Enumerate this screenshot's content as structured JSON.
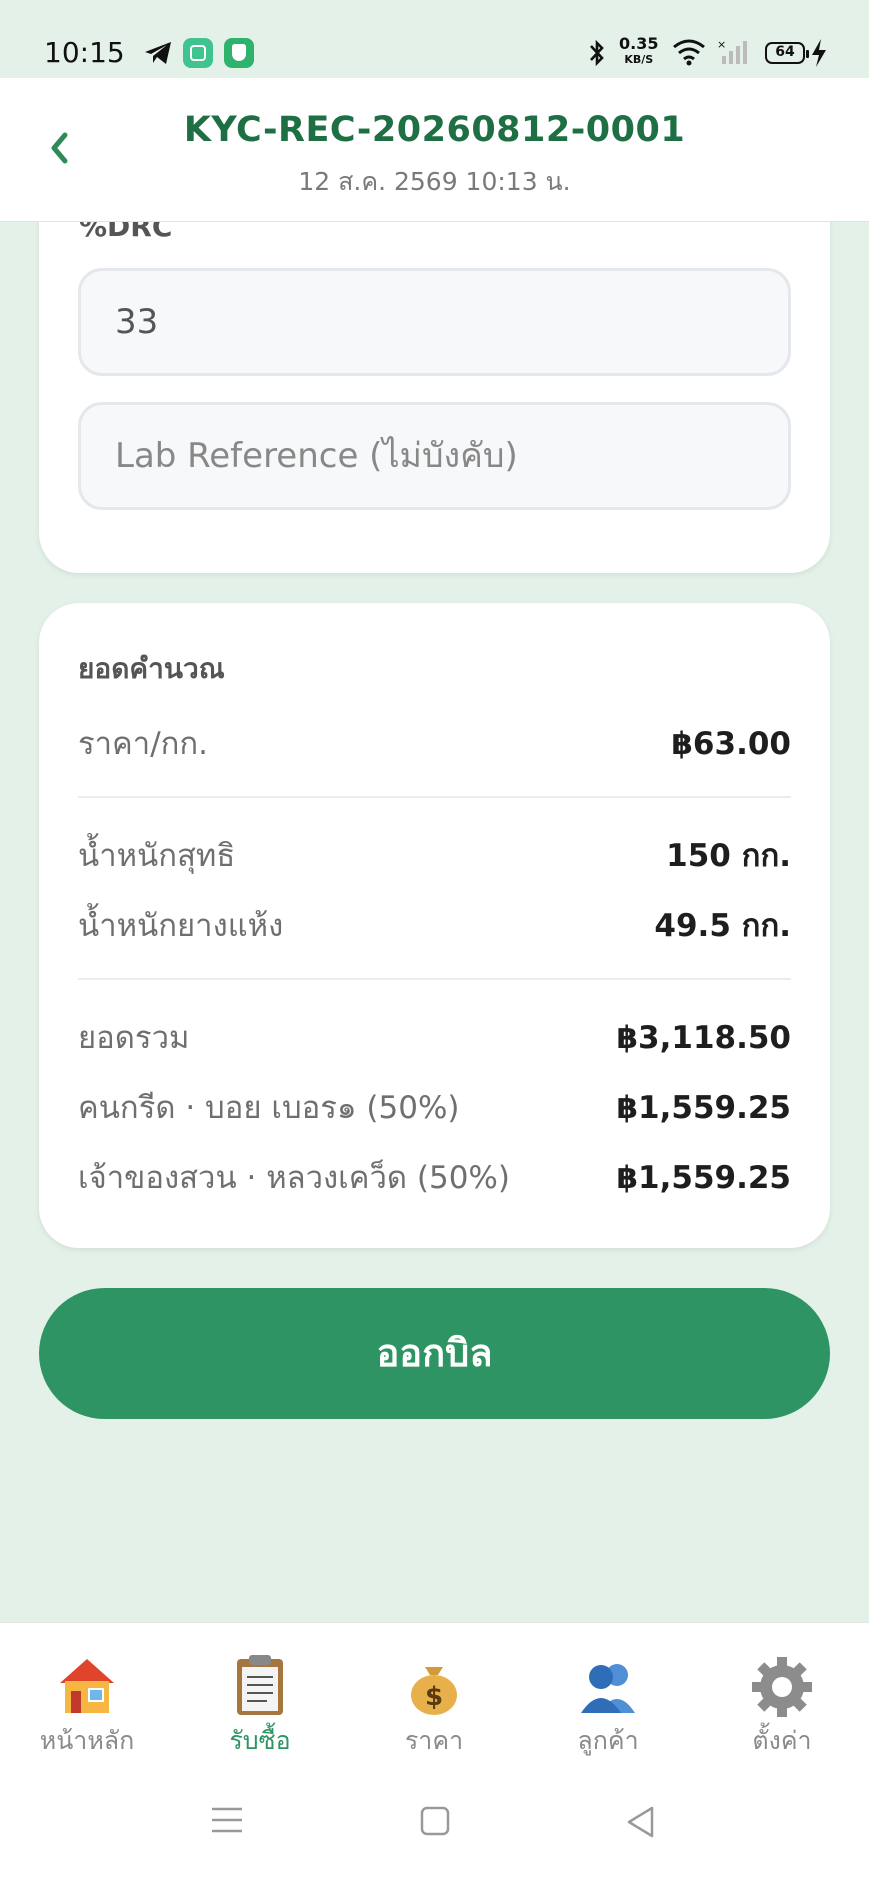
{
  "status_bar": {
    "time": "10:15",
    "network_speed": "0.35",
    "network_unit": "KB/S",
    "battery": "64"
  },
  "header": {
    "title": "KYC-REC-20260812-0001",
    "subtitle": "12 ส.ค. 2569 10:13 น."
  },
  "form": {
    "drc_label": "%DRC",
    "drc_value": "33",
    "lab_reference_placeholder": "Lab Reference (ไม่บังคับ)"
  },
  "calculation": {
    "title": "ยอดคำนวณ",
    "price_per_kg_label": "ราคา/กก.",
    "price_per_kg_value": "฿63.00",
    "net_weight_label": "น้ำหนักสุทธิ",
    "net_weight_value": "150 กก.",
    "dry_rubber_label": "น้ำหนักยางแห้ง",
    "dry_rubber_value": "49.5 กก.",
    "total_label": "ยอดรวม",
    "total_value": "฿3,118.50",
    "tapper_label": "คนกรีด · บอย เบอร๑ (50%)",
    "tapper_value": "฿1,559.25",
    "owner_label": "เจ้าของสวน · หลวงเคว็ด (50%)",
    "owner_value": "฿1,559.25"
  },
  "actions": {
    "issue_bill": "ออกบิล"
  },
  "nav": {
    "items": [
      {
        "label": "หน้าหลัก",
        "icon": "house-icon"
      },
      {
        "label": "รับซื้อ",
        "icon": "clipboard-icon"
      },
      {
        "label": "ราคา",
        "icon": "money-bag-icon"
      },
      {
        "label": "ลูกค้า",
        "icon": "users-icon"
      },
      {
        "label": "ตั้งค่า",
        "icon": "gear-icon"
      }
    ],
    "active_index": 1
  },
  "colors": {
    "primary": "#2f9463",
    "title_green": "#1f6f45",
    "background": "#e3f1e8"
  }
}
